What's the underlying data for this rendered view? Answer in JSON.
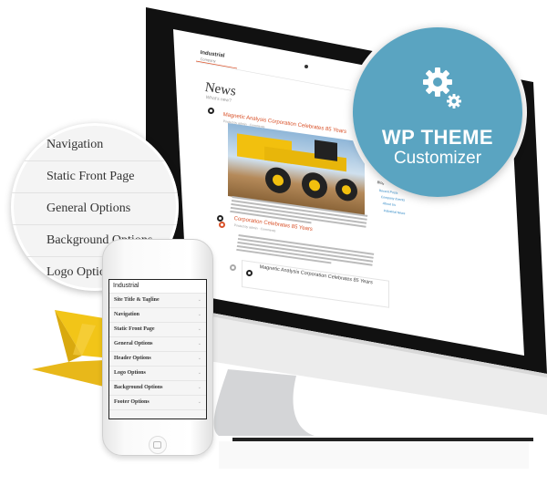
{
  "badge": {
    "title": "WP THEME",
    "subtitle": "Customizer",
    "icon": "gears-icon",
    "color": "#5aa4c1"
  },
  "magnifier": {
    "items": [
      {
        "label": "Navigation"
      },
      {
        "label": "Static Front Page"
      },
      {
        "label": "General Options"
      },
      {
        "label": "Background Options"
      },
      {
        "label": "Logo Options"
      }
    ]
  },
  "phone": {
    "header": "Industrial",
    "items": [
      {
        "label": "Site Title & Tagline"
      },
      {
        "label": "Navigation"
      },
      {
        "label": "Static Front Page"
      },
      {
        "label": "General Options"
      },
      {
        "label": "Header Options"
      },
      {
        "label": "Logo Options"
      },
      {
        "label": "Background Options"
      },
      {
        "label": "Footer Options"
      }
    ],
    "chevron": "⌄"
  },
  "monitor": {
    "site_logo": "Industrial",
    "site_sub": "Company",
    "page_title": "News",
    "page_sub": "What's new?",
    "posts": [
      {
        "title": "Magnetic Analysis Corporation Celebrates 85 Years"
      },
      {
        "title": "Corporation Celebrates 85 Years"
      }
    ],
    "quote": "Magnetic Analysis Corporation Celebrates 85 Years",
    "widget_title": "Blog",
    "widget_links": [
      "Recent Posts",
      "Company Events",
      "About Us",
      "Industrial News"
    ],
    "accent": "#d9532b"
  },
  "ribbon_color": "#f0c020"
}
